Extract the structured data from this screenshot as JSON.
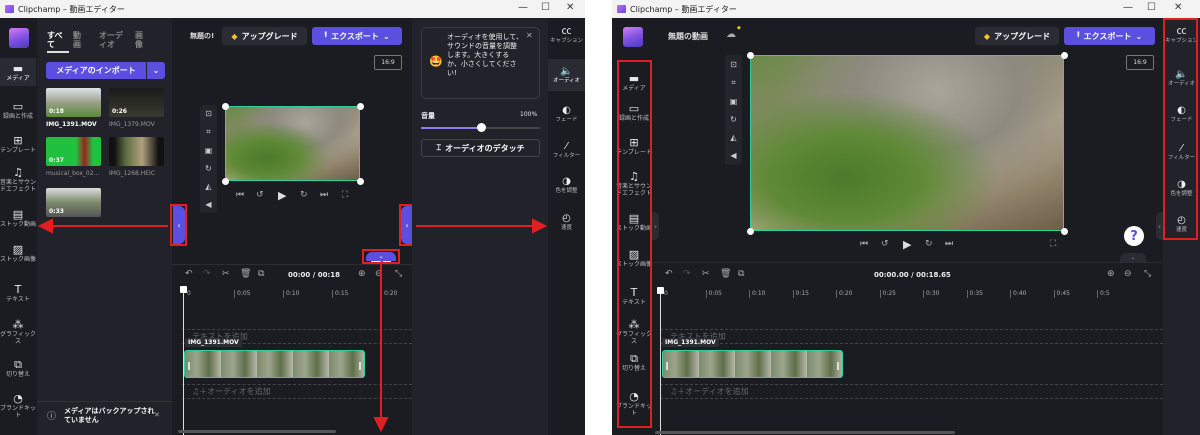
{
  "left_window": {
    "title": "Clipchamp – 動画エディター",
    "nav": [
      {
        "label": "メディア",
        "icon": "folder-icon"
      },
      {
        "label": "録画と作成",
        "icon": "video-camera-icon"
      },
      {
        "label": "テンプレート",
        "icon": "template-icon"
      },
      {
        "label": "音楽とサウンドエフェクト",
        "icon": "music-icon"
      },
      {
        "label": "ストック動画",
        "icon": "film-icon"
      },
      {
        "label": "ストック画像",
        "icon": "image-icon"
      },
      {
        "label": "テキスト",
        "icon": "text-icon"
      },
      {
        "label": "グラフィックス",
        "icon": "shapes-icon"
      },
      {
        "label": "切り替え",
        "icon": "transition-icon"
      },
      {
        "label": "ブランドキット",
        "icon": "brand-kit-icon"
      }
    ],
    "media_tabs": [
      "すべて",
      "動画",
      "オーディオ",
      "画像"
    ],
    "import_label": "メディアのインポート",
    "media": [
      {
        "name": "IMG_1391.MOV",
        "duration": "0:18"
      },
      {
        "name": "IMG_1379.MOV",
        "duration": "0:26"
      },
      {
        "name": "musical_box_02...",
        "duration": "0:37"
      },
      {
        "name": "IMG_1268.HEIC",
        "duration": ""
      },
      {
        "name": "",
        "duration": "0:33"
      }
    ],
    "backup_notice": "メディアはバックアップされていません",
    "project_title": "無題の!",
    "upgrade": "アップグレード",
    "export": "エクスポート",
    "aspect": "16:9",
    "time_current": "00:00",
    "time_total": "00:18",
    "ruler": [
      "0",
      "0:05",
      "0:10",
      "0:15",
      "0:20"
    ],
    "text_track": "テキストを追加",
    "clip_label": "IMG_1391.MOV",
    "audio_track": "＋オーディオを追加",
    "tip": "オーディオを使用して、サウンドの音量を調整します。大きくするか、小さくしてください!",
    "volume_label": "音量",
    "volume_value": "100%",
    "volume_level": 0.5,
    "detach": "オーディオのデタッチ",
    "rail": [
      {
        "label": "キャプション",
        "icon": "captions-icon"
      },
      {
        "label": "オーディオ",
        "icon": "speaker-icon"
      },
      {
        "label": "フェード",
        "icon": "fade-icon"
      },
      {
        "label": "フィルター",
        "icon": "filter-wand-icon"
      },
      {
        "label": "色を調整",
        "icon": "color-adjust-icon"
      },
      {
        "label": "速度",
        "icon": "speed-icon"
      }
    ]
  },
  "right_window": {
    "title": "Clipchamp – 動画エディター",
    "project_title": "無題の動画",
    "upgrade": "アップグレード",
    "export": "エクスポート",
    "aspect": "16:9",
    "time_current": "00:00.00",
    "time_total": "00:18.65",
    "ruler": [
      "0",
      "0:05",
      "0:10",
      "0:15",
      "0:20",
      "0:25",
      "0:30",
      "0:35",
      "0:40",
      "0:45",
      "0:5"
    ],
    "text_track": "テキストを追加",
    "clip_label": "IMG_1391.MOV",
    "audio_track": "＋オーディオを追加"
  },
  "colors": {
    "accent": "#5b4fe0",
    "selection": "#2ed0a0",
    "annotation": "#e02020"
  }
}
